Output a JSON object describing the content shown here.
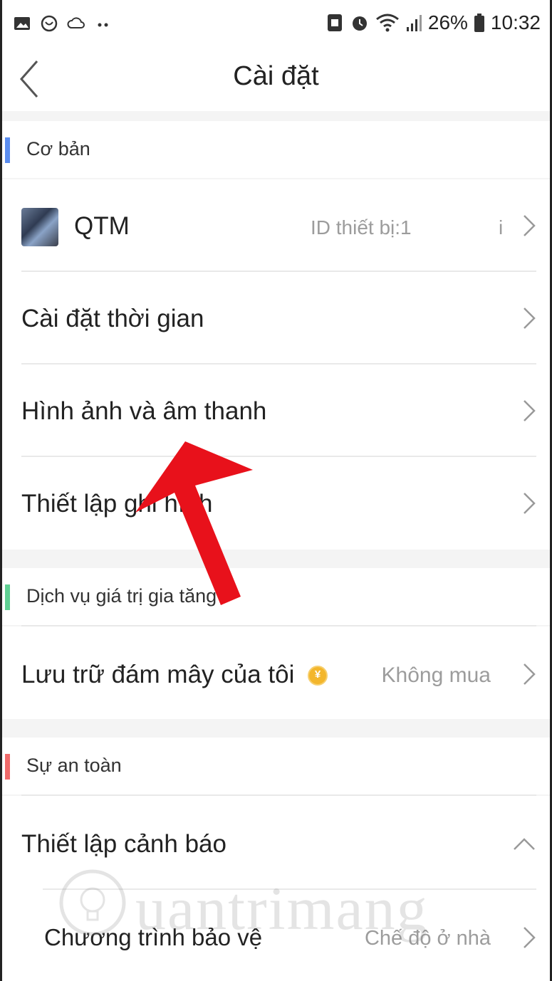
{
  "status_bar": {
    "battery": "26%",
    "time": "10:32"
  },
  "header": {
    "title": "Cài đặt"
  },
  "sections": {
    "basic": {
      "label": "Cơ bản",
      "accent": "#5b8def"
    },
    "value_added": {
      "label": "Dịch vụ giá trị gia tăng",
      "accent": "#5fcf93"
    },
    "safety": {
      "label": "Sự an toàn",
      "accent": "#f06a6a"
    }
  },
  "items": {
    "device": {
      "label": "QTM",
      "value": "ID thiết bị:1",
      "value_tail": "i"
    },
    "time_settings": {
      "label": "Cài đặt thời gian"
    },
    "image_sound": {
      "label": "Hình ảnh và âm thanh"
    },
    "record_settings": {
      "label": "Thiết lập ghi hình"
    },
    "cloud_storage": {
      "label": "Lưu trữ đám mây của tôi",
      "value": "Không mua",
      "coin_symbol": "¥"
    },
    "alert_settings": {
      "label": "Thiết lập cảnh báo"
    },
    "protection_program": {
      "label": "Chương trình bảo vệ",
      "value": "Chế độ ở nhà"
    }
  },
  "watermark": {
    "text": "uantrimang"
  },
  "icons": [
    "gallery-icon",
    "chat-icon",
    "cloud-icon",
    "more-icon",
    "sim-icon",
    "alarm-icon",
    "wifi-icon",
    "signal-icon",
    "battery-icon",
    "back-arrow-icon",
    "chevron-right-icon",
    "chevron-up-icon",
    "coin-icon"
  ]
}
